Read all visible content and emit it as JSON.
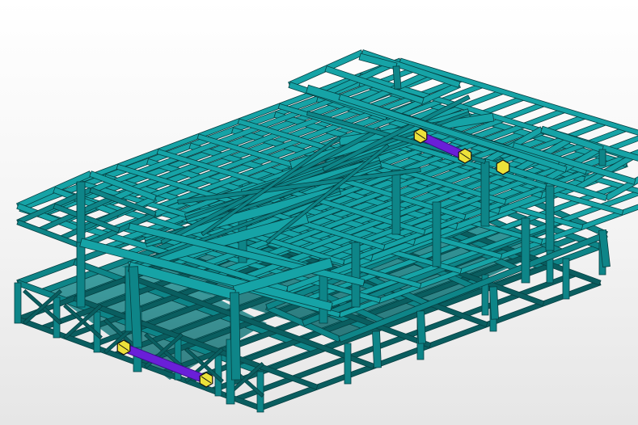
{
  "scene": {
    "background_top": "#ffffff",
    "background_bottom": "#e6e6e6",
    "steel_light": "#16a3a6",
    "steel_mid": "#0e8588",
    "steel_dark": "#0a5e60",
    "edge_color": "#063f41",
    "support_beam_color": "#6a1fd8",
    "support_face_color": "#ece13a",
    "support_edge_color": "#111111"
  },
  "supports": [
    {
      "name": "support-front-left"
    },
    {
      "name": "support-front-right"
    },
    {
      "name": "support-back-left"
    },
    {
      "name": "support-back-right"
    }
  ]
}
